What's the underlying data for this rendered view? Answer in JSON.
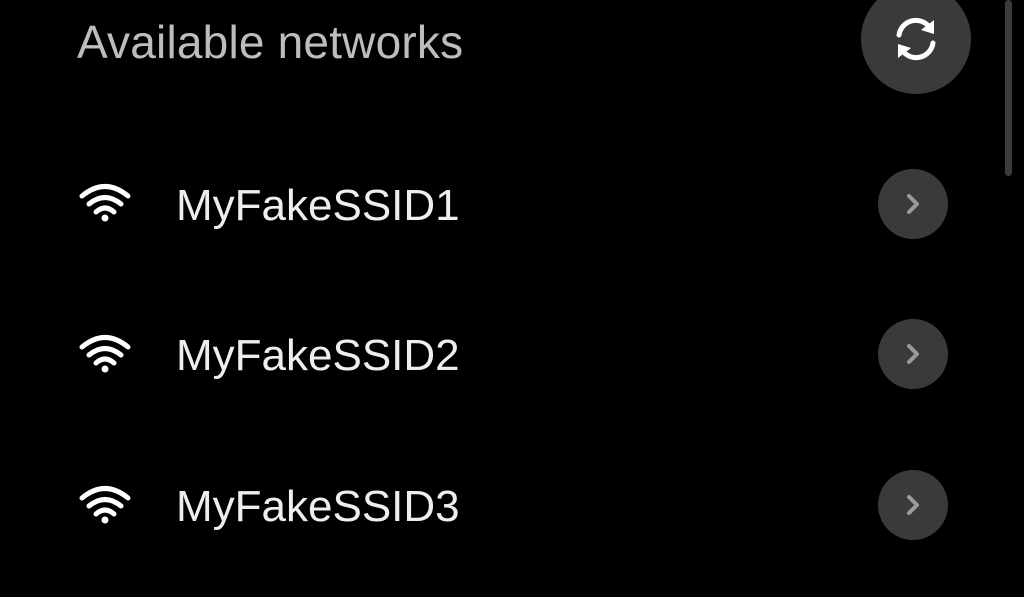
{
  "header": {
    "title": "Available networks",
    "refresh_icon": "refresh-icon"
  },
  "networks": [
    {
      "ssid": "MyFakeSSID1",
      "signal_icon": "wifi-signal-icon",
      "action_icon": "chevron-right-icon"
    },
    {
      "ssid": "MyFakeSSID2",
      "signal_icon": "wifi-signal-icon",
      "action_icon": "chevron-right-icon"
    },
    {
      "ssid": "MyFakeSSID3",
      "signal_icon": "wifi-signal-icon",
      "action_icon": "chevron-right-icon"
    }
  ],
  "colors": {
    "background": "#000000",
    "title_text": "#bdbdbd",
    "item_text": "#eeeeee",
    "button_bg": "#3a3a3a",
    "icon": "#ffffff",
    "chevron": "#9a9a9a"
  }
}
